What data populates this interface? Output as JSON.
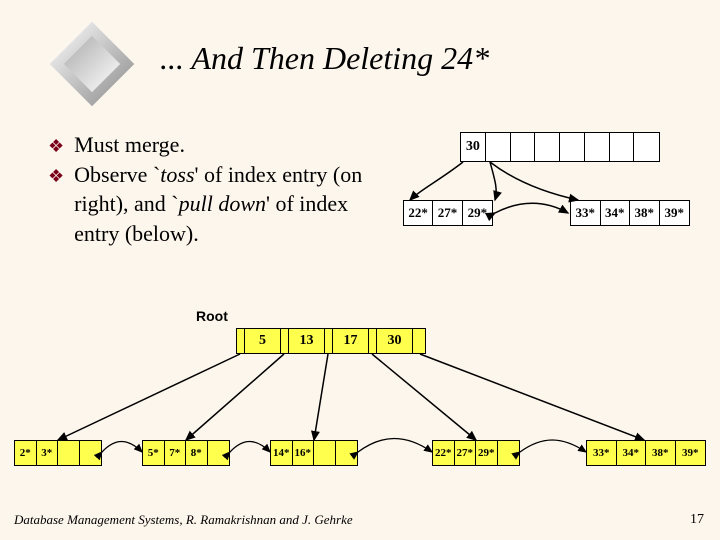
{
  "title": "... And Then Deleting 24*",
  "bullets": [
    {
      "plain1": "Must merge.",
      "toss": "",
      "plain2": "",
      "pull": "",
      "plain3": ""
    },
    {
      "plain1": "Observe `",
      "toss": "toss",
      "plain2": "' of index entry (on right), and `",
      "pull": "pull down",
      "plain3": "' of index entry (below)."
    }
  ],
  "top_index": [
    "30",
    "",
    "",
    "",
    "",
    "",
    "",
    ""
  ],
  "top_leaf_left": [
    "22*",
    "27*",
    "29*"
  ],
  "top_leaf_right": [
    "33*",
    "34*",
    "38*",
    "39*"
  ],
  "root_label": "Root",
  "root_keys": [
    "5",
    "13",
    "17",
    "30"
  ],
  "leaves": [
    [
      "2*",
      "3*",
      "",
      ""
    ],
    [
      "5*",
      "7*",
      "8*",
      ""
    ],
    [
      "14*",
      "16*",
      "",
      ""
    ],
    [
      "22*",
      "27*",
      "29*",
      ""
    ],
    [
      "33*",
      "34*",
      "38*",
      "39*"
    ]
  ],
  "footer_left": "Database Management Systems, R. Ramakrishnan and J. Gehrke",
  "footer_right": "17",
  "chart_data": {
    "type": "table",
    "title": "B+ tree after deleting 24* — merge with toss and pull-down",
    "operations": [
      "merge leaves",
      "toss index entry (right)",
      "pull down index entry (below)"
    ],
    "partial_right_subtree": {
      "index_keys": [
        30
      ],
      "leaves": [
        [
          22,
          27,
          29
        ],
        [
          33,
          34,
          38,
          39
        ]
      ]
    },
    "resulting_tree": {
      "root_keys": [
        5,
        13,
        17,
        30
      ],
      "leaves": [
        [
          2,
          3
        ],
        [
          5,
          7,
          8
        ],
        [
          14,
          16
        ],
        [
          22,
          27,
          29
        ],
        [
          33,
          34,
          38,
          39
        ]
      ]
    }
  }
}
